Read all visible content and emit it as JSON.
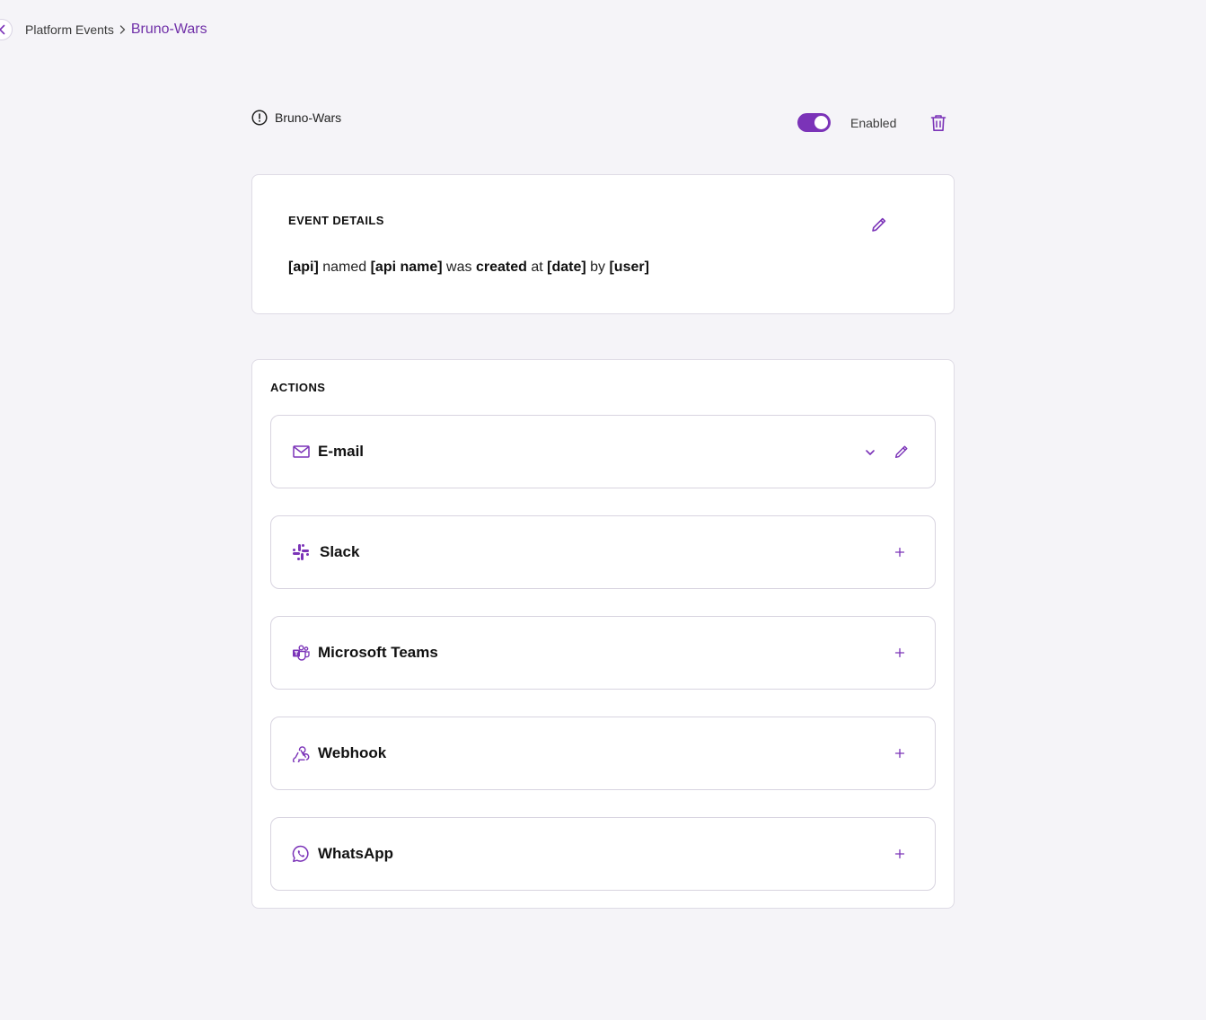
{
  "breadcrumb": {
    "parent": "Platform Events",
    "current": "Bruno-Wars"
  },
  "header": {
    "event_name": "Bruno-Wars",
    "toggle_label": "Enabled",
    "toggle_on": true
  },
  "event_details": {
    "heading": "EVENT DETAILS",
    "sentence": {
      "p1": "[api]",
      "p2": " named ",
      "p3": "[api name]",
      "p4": " was ",
      "p5": "created",
      "p6": " at ",
      "p7": "[date]",
      "p8": " by ",
      "p9": "[user]"
    }
  },
  "actions": {
    "heading": "ACTIONS",
    "items": [
      {
        "label": "E-mail",
        "icon": "mail-icon",
        "state": "configured"
      },
      {
        "label": "Slack",
        "icon": "slack-icon",
        "state": "add"
      },
      {
        "label": "Microsoft Teams",
        "icon": "teams-icon",
        "state": "add"
      },
      {
        "label": "Webhook",
        "icon": "webhook-icon",
        "state": "add"
      },
      {
        "label": "WhatsApp",
        "icon": "whatsapp-icon",
        "state": "add"
      }
    ]
  },
  "colors": {
    "accent": "#7b33b8",
    "background": "#f5f4f8",
    "card": "#ffffff"
  }
}
